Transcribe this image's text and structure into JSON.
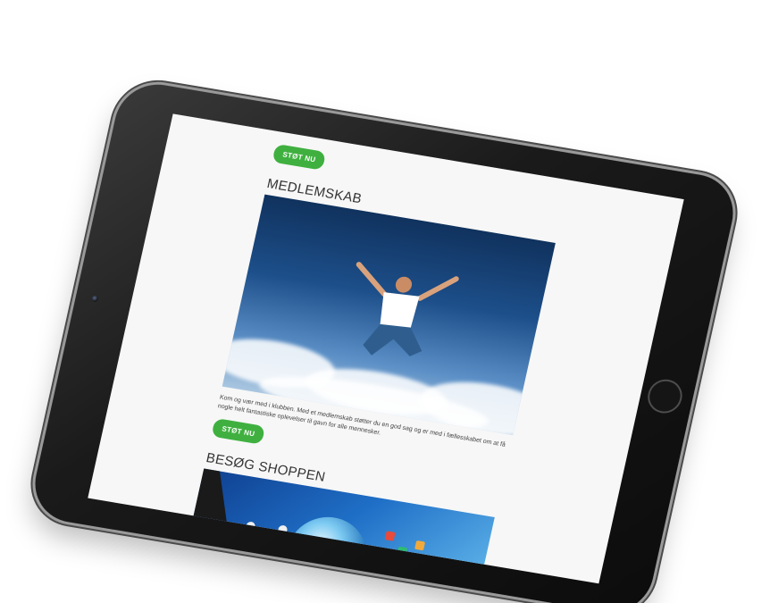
{
  "page": {
    "buttons": {
      "support_top": "STØT NU",
      "support_bottom": "STØT NU"
    },
    "membership": {
      "title": "MEDLEMSKAB",
      "body": "Kom og vær med i klubben. Med et medlemskab støtter du en god sag og er med i fællesskabet om at få nogle helt fantastiske oplevelser til gavn for alle mennesker."
    },
    "shop": {
      "title": "BESØG SHOPPEN"
    }
  },
  "colors": {
    "accent": "#3fb03f",
    "tablet_frame": "#1a1a1a",
    "screen_background": "#f7f7f7"
  },
  "icons": {
    "camera": "camera-icon",
    "home": "home-button"
  }
}
